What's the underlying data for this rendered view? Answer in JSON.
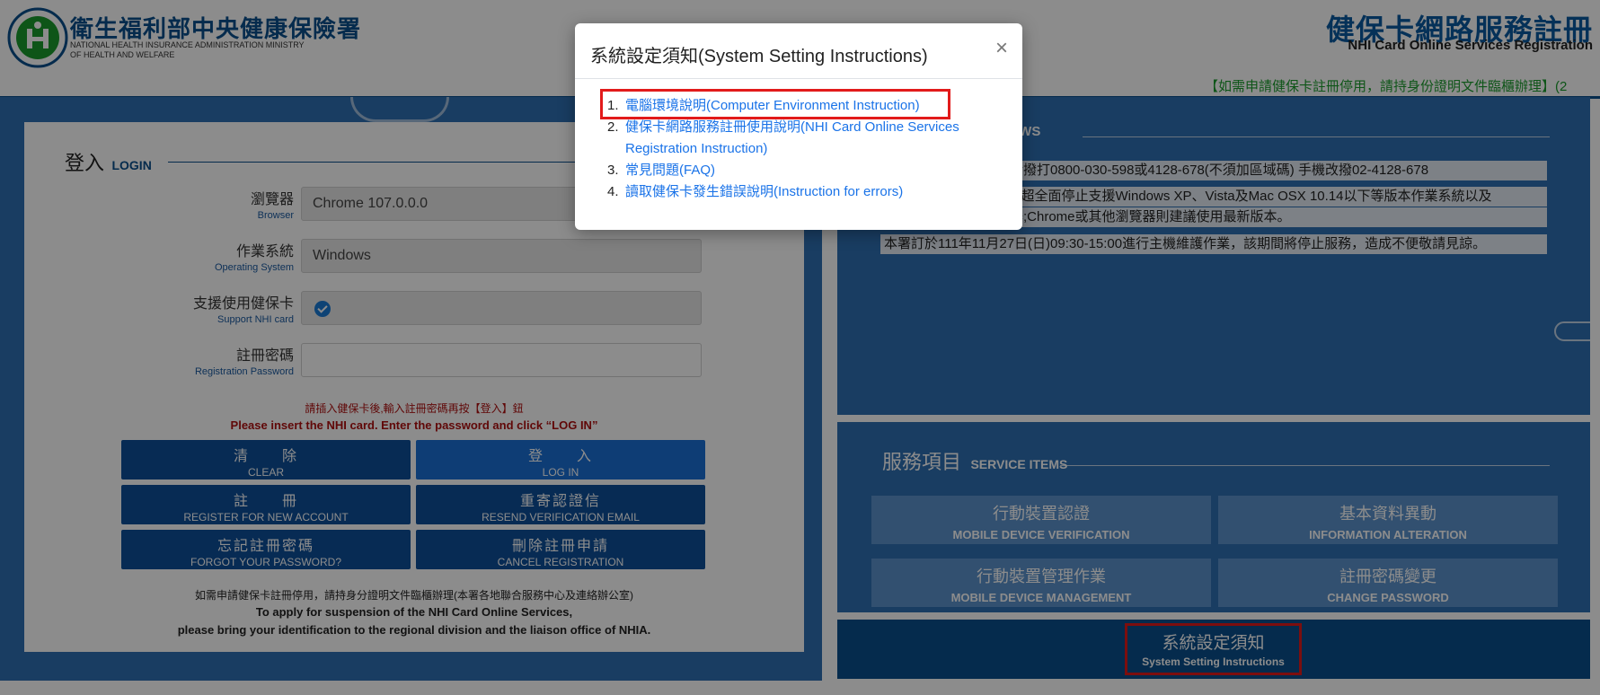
{
  "header": {
    "org_name": "衛生福利部中央健康保險署",
    "org_sub_1": "NATIONAL HEALTH INSURANCE ADMINISTRATION MINISTRY",
    "org_sub_2": "OF HEALTH AND WELFARE",
    "site_title": "健保卡網路服務註冊",
    "site_sub": "NHI Card Online Services Registration",
    "marquee": "【如需申請健保卡註冊停用，請持身份證明文件臨櫃辦理】(2"
  },
  "login": {
    "title_cn": "登入",
    "title_en": "LOGIN",
    "browser": {
      "label_cn": "瀏覽器",
      "label_en": "Browser",
      "value": "Chrome 107.0.0.0"
    },
    "os": {
      "label_cn": "作業系統",
      "label_en": "Operating System",
      "value": "Windows"
    },
    "nhi": {
      "label_cn": "支援使用健保卡",
      "label_en": "Support NHI card"
    },
    "password": {
      "label_cn": "註冊密碼",
      "label_en": "Registration Password",
      "value": ""
    },
    "notice_cn": "請插入健保卡後,輸入註冊密碼再按【登入】鈕",
    "notice_en": "Please insert the NHI card. Enter the password and click “LOG IN”",
    "buttons": {
      "clear": {
        "cn": "清　　除",
        "en": "CLEAR"
      },
      "login": {
        "cn": "登　　入",
        "en": "LOG IN"
      },
      "register": {
        "cn": "註　　冊",
        "en": "REGISTER FOR NEW ACCOUNT"
      },
      "resend": {
        "cn": "重寄認證信",
        "en": "RESEND VERIFICATION EMAIL"
      },
      "forgot": {
        "cn": "忘記註冊密碼",
        "en": "FORGOT YOUR PASSWORD?"
      },
      "cancel": {
        "cn": "刪除註冊申請",
        "en": "CANCEL REGISTRATION"
      }
    },
    "footer_1": "如需申請健保卡註冊停用，請持身分證明文件臨櫃辦理(本署各地聯合服務中心及連絡辦公室)",
    "footer_2": "To apply for suspension of the NHI Card Online Services,",
    "footer_3": "please bring your identification to the regional division and the liaison office of NHIA."
  },
  "news": {
    "title": "T NEWS",
    "items": [
      "市話撥打0800-030-598或4128-678(不須加區域碼) 手機改撥02-4128-678",
      "1 日超全面停止支援Windows XP、Vista及Mac OSX 10.14以下等版本作業系統以及",
      "覽器;Chrome或其他瀏覽器則建議使用最新版本。",
      "本署訂於111年11月27日(日)09:30-15:00進行主機維護作業，該期間將停止服務，造成不便敬請見諒。"
    ]
  },
  "services": {
    "title_cn": "服務項目",
    "title_en": "SERVICE ITEMS",
    "items": [
      {
        "cn": "行動裝置認證",
        "en": "MOBILE DEVICE VERIFICATION"
      },
      {
        "cn": "基本資料異動",
        "en": "INFORMATION ALTERATION"
      },
      {
        "cn": "行動裝置管理作業",
        "en": "MOBILE DEVICE MANAGEMENT"
      },
      {
        "cn": "註冊密碼變更",
        "en": "CHANGE PASSWORD"
      }
    ]
  },
  "system_button": {
    "cn": "系統設定須知",
    "en": "System Setting Instructions"
  },
  "modal": {
    "title": "系統設定須知(System Setting Instructions)",
    "close": "×",
    "items": [
      {
        "num": "1.",
        "text": "電腦環境說明(Computer Environment Instruction)"
      },
      {
        "num": "2.",
        "text": "健保卡網路服務註冊使用說明(NHI Card Online Services Registration Instruction)"
      },
      {
        "num": "3.",
        "text": "常見問題(FAQ)"
      },
      {
        "num": "4.",
        "text": "讀取健保卡發生錯誤說明(Instruction for errors)"
      }
    ]
  },
  "colors": {
    "brand_blue": "#0a4f8c",
    "panel_blue": "#2f6fb2",
    "link_blue": "#1a73e8",
    "highlight_red": "#e21b1b",
    "notice_red": "#b01010",
    "marquee_green": "#1a9c2c"
  }
}
